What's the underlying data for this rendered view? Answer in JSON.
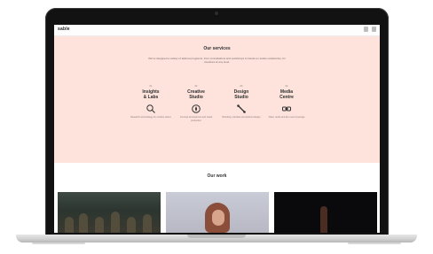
{
  "site": {
    "logo": "sable",
    "top_icons": [
      "search-icon",
      "menu-icon"
    ]
  },
  "hero": {
    "title": "Our services",
    "description": "We've designed a variety of tailored programs, from consultations and workshops to hands-on studio residencies, for creatives at any level.",
    "services": [
      {
        "kicker": "01",
        "name": "Insights\n& Labs",
        "icon": "magnifier-icon",
        "caption": "Research and strategy for creative teams"
      },
      {
        "kicker": "02",
        "name": "Creative\nStudio",
        "icon": "compass-icon",
        "caption": "Concept development and visual production"
      },
      {
        "kicker": "03",
        "name": "Design\nStudio",
        "icon": "pencil-icon",
        "caption": "Branding, interface and product design"
      },
      {
        "kicker": "04",
        "name": "Media\nCentre",
        "icon": "link-icon",
        "caption": "Video, audio and live event coverage"
      }
    ]
  },
  "work": {
    "title": "Our work"
  },
  "colors": {
    "hero_background": "#fde3dc",
    "bezel": "#121212"
  }
}
